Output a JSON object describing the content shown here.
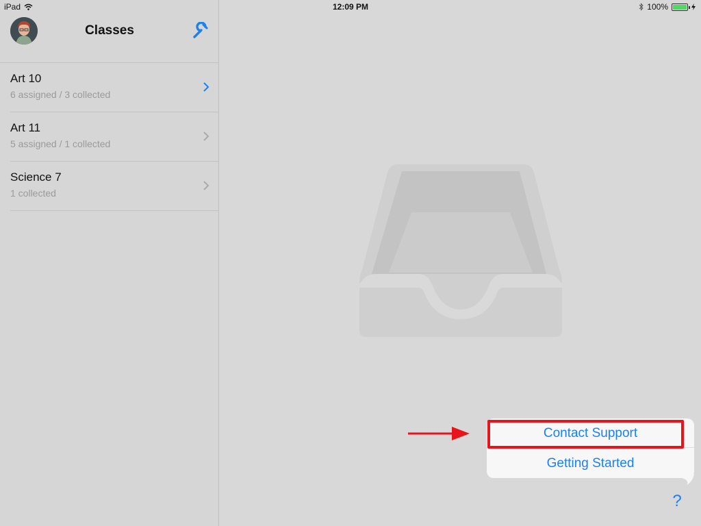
{
  "status_bar": {
    "device": "iPad",
    "time": "12:09 PM",
    "battery": "100%",
    "battery_level": 1.0
  },
  "sidebar": {
    "title": "Classes",
    "classes": [
      {
        "name": "Art 10",
        "meta": "6 assigned / 3 collected",
        "selected": true
      },
      {
        "name": "Art 11",
        "meta": "5 assigned / 1 collected",
        "selected": false
      },
      {
        "name": "Science 7",
        "meta": "1 collected",
        "selected": false
      }
    ]
  },
  "popover": {
    "items": [
      "Contact Support",
      "Getting Started"
    ]
  },
  "help": {
    "label": "?"
  },
  "icons": {
    "wifi": "wifi-icon",
    "bluetooth": "bluetooth-icon",
    "battery": "battery-icon",
    "settings": "wrench-icon",
    "empty": "inbox-tray-icon"
  },
  "colors": {
    "accent": "#1a82f0",
    "highlight": "#e8141c",
    "background": "#d8d8d8"
  }
}
